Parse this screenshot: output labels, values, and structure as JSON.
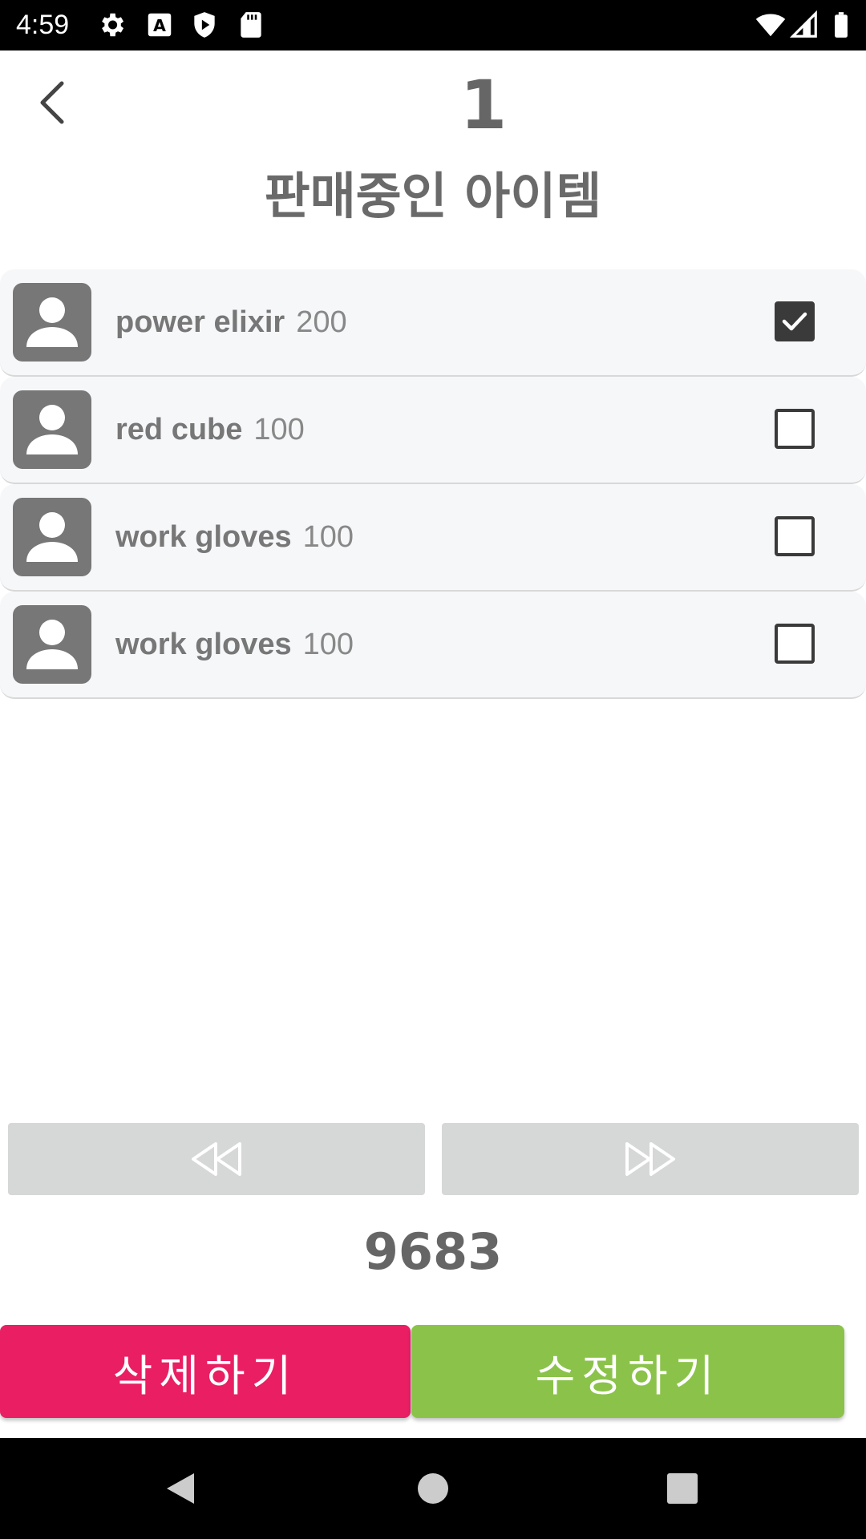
{
  "status_bar": {
    "time": "4:59",
    "icons": [
      "gear-icon",
      "font-a-icon",
      "shield-play-icon",
      "sd-card-icon",
      "wifi-icon",
      "cell-signal-icon",
      "battery-icon"
    ]
  },
  "header": {
    "back_icon": "chevron-left-icon",
    "page_number": "1",
    "title": "판매중인 아이템"
  },
  "items": [
    {
      "name": "power elixir",
      "price": "200",
      "checked": true
    },
    {
      "name": "red cube",
      "price": "100",
      "checked": false
    },
    {
      "name": "work gloves",
      "price": "100",
      "checked": false
    },
    {
      "name": "work gloves",
      "price": "100",
      "checked": false
    }
  ],
  "pager": {
    "prev_icon": "rewind-icon",
    "next_icon": "fast-forward-icon"
  },
  "total": "9683",
  "actions": {
    "delete_label": "삭제하기",
    "edit_label": "수정하기"
  },
  "nav_bar": {
    "icons": [
      "back-triangle-icon",
      "home-circle-icon",
      "recents-square-icon"
    ]
  },
  "colors": {
    "delete": "#e91e63",
    "edit": "#8bc34a",
    "pager": "#d6d7d7",
    "row_bg": "#f6f7f9"
  }
}
